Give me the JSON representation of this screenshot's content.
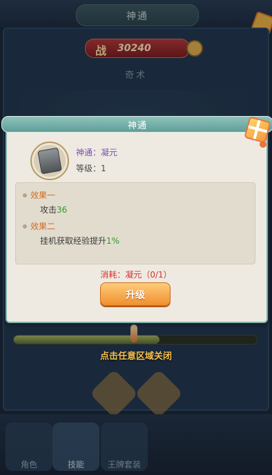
{
  "background": {
    "title": "神通",
    "power_label": "战",
    "power_value": "30240",
    "subtitle": "奇术",
    "progress_fraction": 0.6,
    "tabs": [
      "角色",
      "技能",
      "王牌套装"
    ]
  },
  "dialog": {
    "title": "神通",
    "skill_name_label": "神通：",
    "skill_name_value": "凝元",
    "level_label": "等级：",
    "level_value": "1",
    "effects": [
      {
        "heading": "效果一",
        "text_prefix": "攻击",
        "text_value": "36",
        "text_suffix": ""
      },
      {
        "heading": "效果二",
        "text_prefix": "挂机获取经验提升",
        "text_value": "1%",
        "text_suffix": ""
      }
    ],
    "cost_text": "消耗：凝元（0/1）",
    "upgrade_label": "升级"
  },
  "close_hint": "点击任意区域关闭",
  "colors": {
    "dialog_bg": "#eeeae1",
    "header": "#7fb1a9",
    "effect_heading": "#d46a1e",
    "value_green": "#2f9a2f",
    "cost_red": "#d63030",
    "button": "#f08f2e"
  }
}
